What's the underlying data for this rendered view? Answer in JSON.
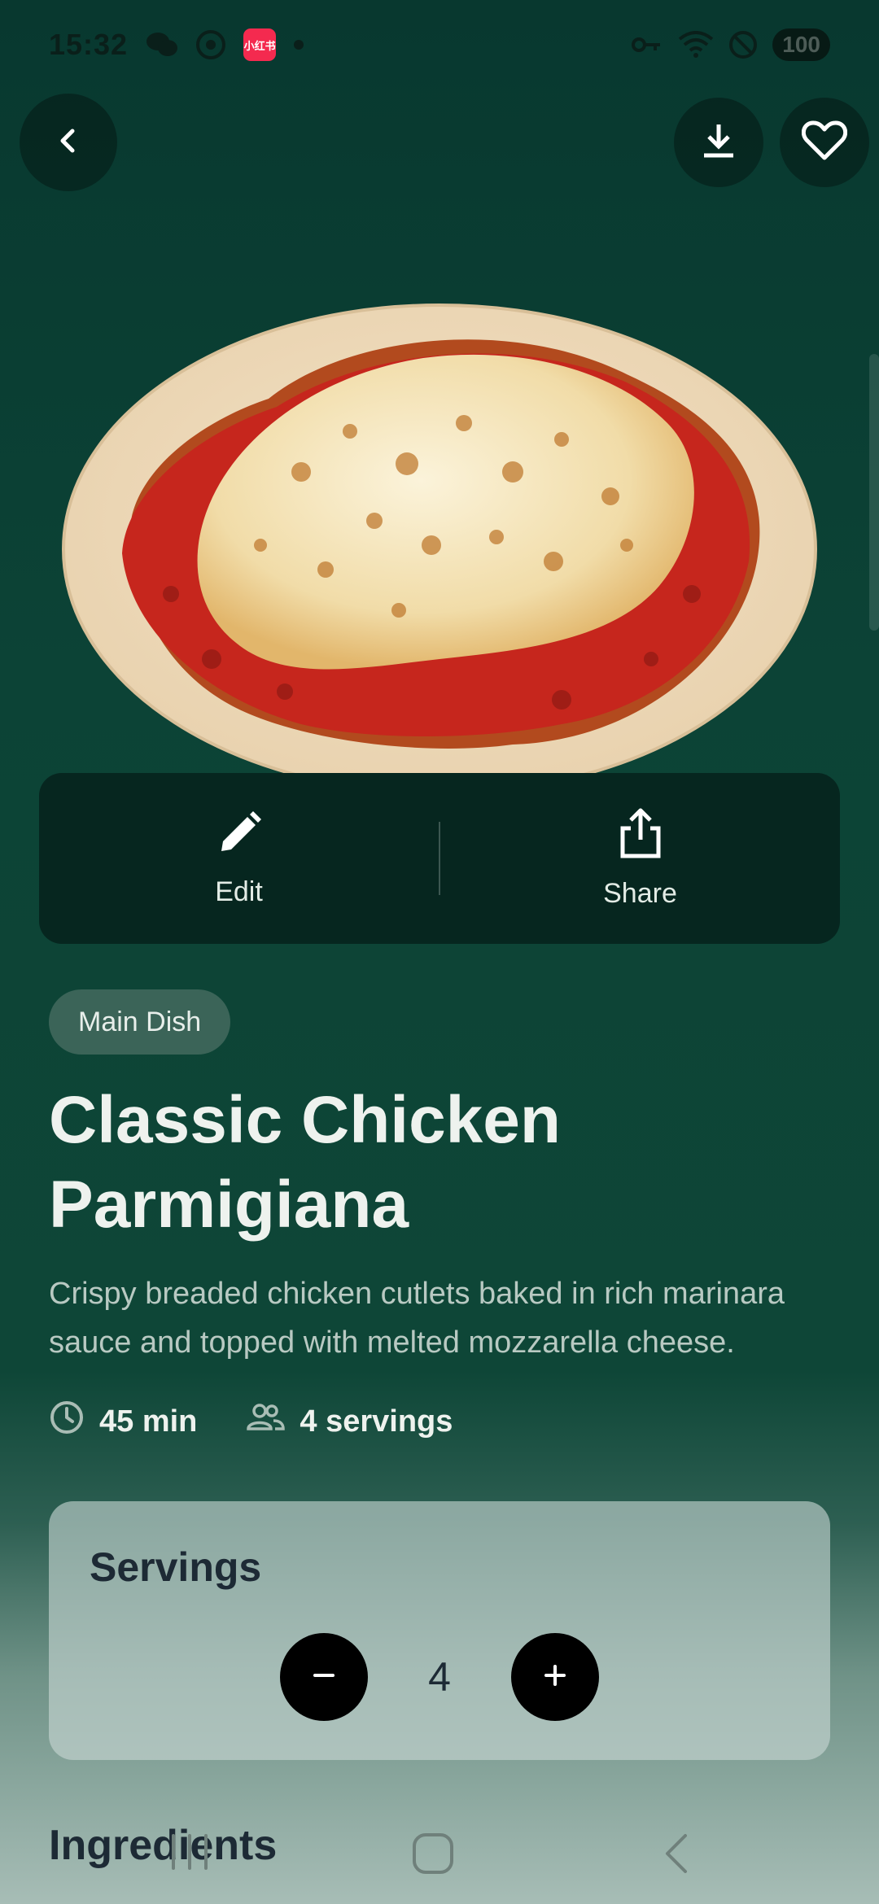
{
  "status_bar": {
    "time": "15:32",
    "app_badge": "小红书",
    "battery": "100",
    "icons": [
      "wechat-icon",
      "chrome-icon",
      "key-icon",
      "wifi-icon",
      "dnd-icon"
    ]
  },
  "top_bar": {
    "back_icon": "chevron-left-icon",
    "download_icon": "download-icon",
    "favorite_icon": "heart-outline-icon"
  },
  "actions": {
    "edit_label": "Edit",
    "share_label": "Share"
  },
  "recipe": {
    "category": "Main Dish",
    "title": "Classic Chicken Parmigiana",
    "description": "Crispy breaded chicken cutlets baked in rich marinara sauce and topped with melted mozzarella cheese.",
    "time": "45 min",
    "servings_text": "4 servings"
  },
  "servings_card": {
    "title": "Servings",
    "value": "4",
    "decrement_icon": "minus-icon",
    "increment_icon": "plus-icon"
  },
  "ingredients": {
    "heading": "Ingredients"
  },
  "colors": {
    "background_top": "#08382f",
    "card_dark": "#06261f",
    "chip": "#3b6458",
    "stepper_button": "#000000"
  }
}
